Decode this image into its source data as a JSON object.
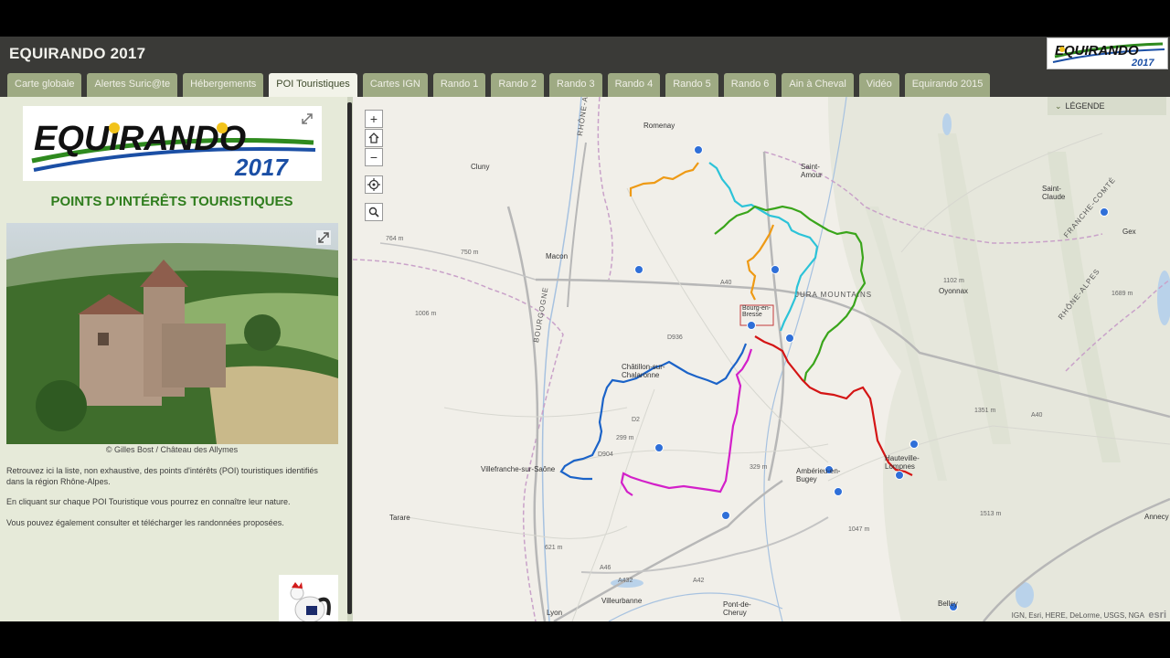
{
  "app": {
    "title": "EQUIRANDO 2017"
  },
  "tabs": [
    {
      "label": "Carte globale",
      "active": false
    },
    {
      "label": "Alertes Suric@te",
      "active": false
    },
    {
      "label": "Hébergements",
      "active": false
    },
    {
      "label": "POI Touristiques",
      "active": true
    },
    {
      "label": "Cartes IGN",
      "active": false
    },
    {
      "label": "Rando 1",
      "active": false
    },
    {
      "label": "Rando 2",
      "active": false
    },
    {
      "label": "Rando 3",
      "active": false
    },
    {
      "label": "Rando 4",
      "active": false
    },
    {
      "label": "Rando 5",
      "active": false
    },
    {
      "label": "Rando 6",
      "active": false
    },
    {
      "label": "Ain à Cheval",
      "active": false
    },
    {
      "label": "Vidéo",
      "active": false
    },
    {
      "label": "Equirando 2015",
      "active": false
    }
  ],
  "logo": {
    "word": "EQUIRANDO",
    "year": "2017"
  },
  "sidebar": {
    "heading": "POINTS D'INTÉRÊTS TOURISTIQUES",
    "caption": "© Gilles Bost / Château des Allymes",
    "para1": "Retrouvez ici la liste, non exhaustive, des points d'intérêts (POI) touristiques identifiés dans la région Rhône-Alpes.",
    "para2": "En cliquant sur chaque POI Touristique vous pourrez en connaître leur nature.",
    "para3": "Vous pouvez également consulter et télécharger les randonnées proposées."
  },
  "map": {
    "legend_label": "LÉGENDE",
    "attribution": "IGN, Esri, HERE, DeLorme, USGS, NGA",
    "esri": "esri",
    "labels": {
      "romenay": "Romenay",
      "cluny": "Cluny",
      "macon": "Macon",
      "saint_amour": "Saint-\nAmour",
      "saint_claude": "Saint-\nClaude",
      "gex": "Gex",
      "oyonnax": "Oyonnax",
      "jura": "JURA MOUNTAINS",
      "bourg": "Bourg-en-\nBresse",
      "chatillon": "Châtillon-sur-\nChalaronne",
      "villefranche": "Villefranche-sur-Saône",
      "amberieu": "Ambérieu-en-\nBugey",
      "hauteville": "Hauteville-\nLompnes",
      "tarare": "Tarare",
      "lyon": "Lyon",
      "villeurbanne": "Villeurbanne",
      "pont": "Pont-de-\nCheruy",
      "belley": "Belley",
      "annecy": "Annecy",
      "rhone_alpes": "RHÔNE-ALPES",
      "bourgogne": "BOURGOGNE",
      "franche": "FRANCHE-COMTÉ",
      "rhone_alpes2": "RHÔNE-ALPES",
      "a40": "A40",
      "a42": "A42",
      "a432": "A432",
      "a46": "A46",
      "d936": "D936",
      "d904": "D904",
      "d2": "D2",
      "a40b": "A40",
      "e764": "764 m",
      "e750": "750 m",
      "e1006": "1006 m",
      "e299": "299 m",
      "e329": "329 m",
      "e1102": "1102 m",
      "e1351": "1351 m",
      "e1047": "1047 m",
      "e1513": "1513 m",
      "e621": "621 m",
      "e1689": "1689 m"
    }
  },
  "colors": {
    "orange_route": "#ee9a15",
    "cyan_route": "#2cc3d8",
    "green_route": "#3aa51b",
    "red_route": "#d41515",
    "blue_route": "#1b63c8",
    "magenta_route": "#d320c9",
    "poi_marker": "#2f6fd8",
    "tab_bg": "#9eaa83",
    "heading_green": "#2f7d1d"
  },
  "icons": [
    "expand-icon",
    "zoom-in-icon",
    "home-icon",
    "zoom-out-icon",
    "locate-icon",
    "search-icon",
    "chevron-down-icon",
    "poi-marker-icon"
  ]
}
